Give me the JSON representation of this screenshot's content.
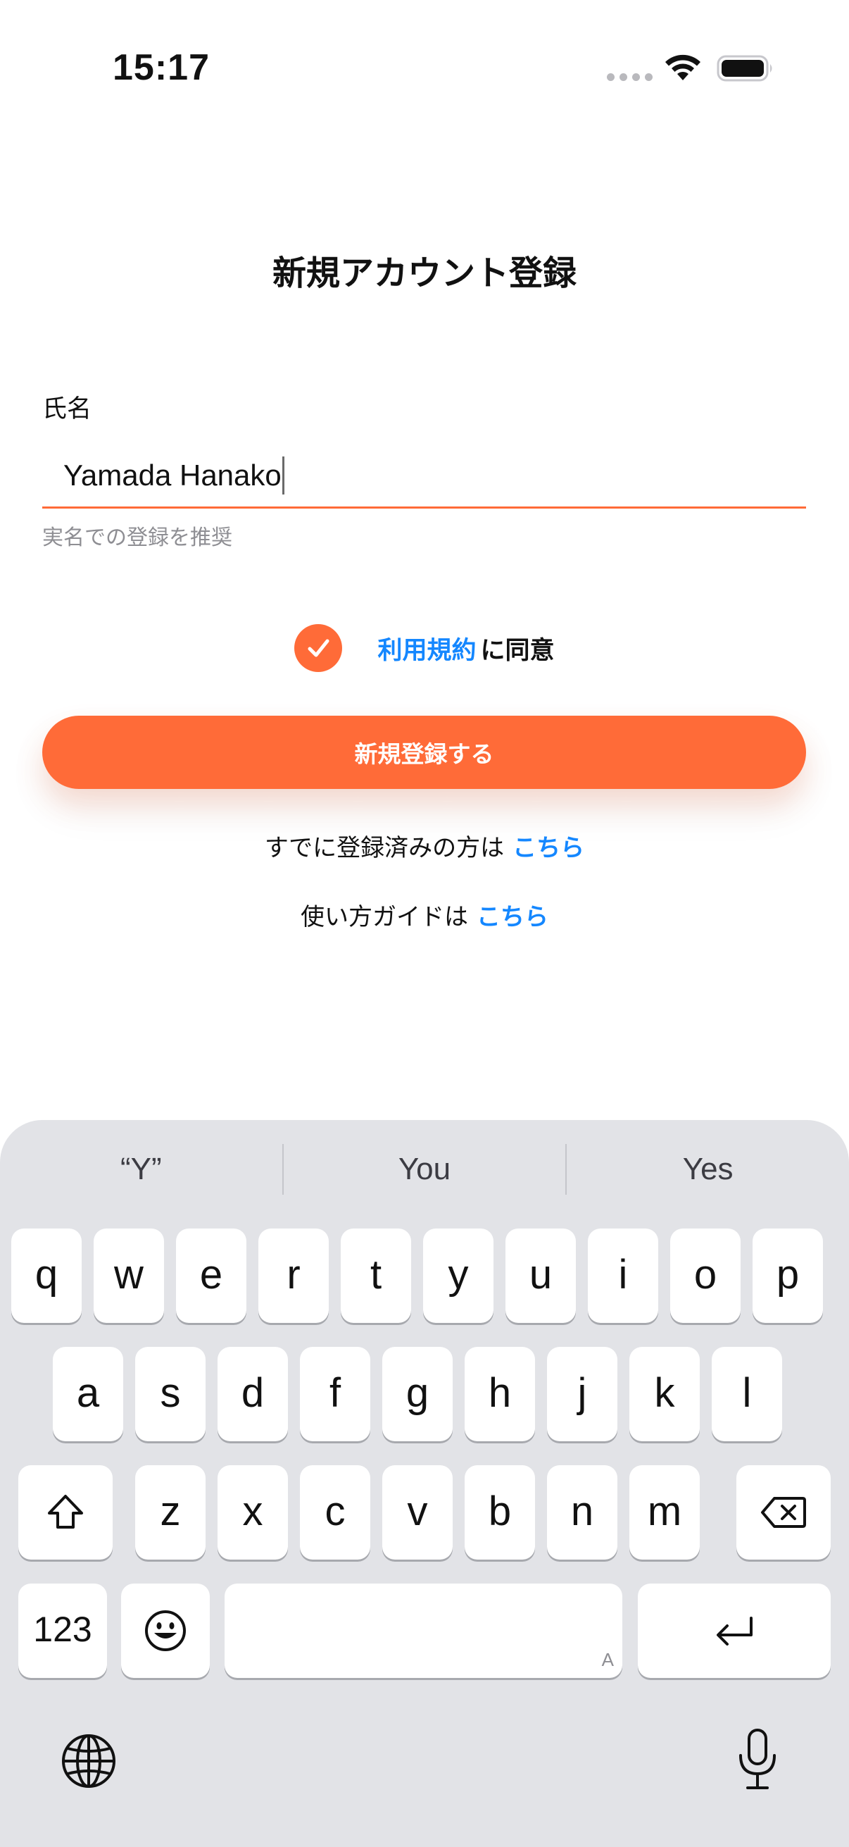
{
  "status_bar": {
    "time": "15:17",
    "icons": [
      "signal-dots-icon",
      "wifi-icon",
      "battery-icon"
    ]
  },
  "page": {
    "title": "新規アカウント登録"
  },
  "form": {
    "name_label": "氏名",
    "name_value": "Yamada Hanako",
    "name_hint": "実名での登録を推奨",
    "terms_checked": true,
    "terms_link": "利用規約",
    "terms_text": "に同意",
    "register_button": "新規登録する"
  },
  "links": {
    "login_text": "すでに登録済みの方は",
    "login_link": "こちら",
    "guide_text": "使い方ガイドは",
    "guide_link": "こちら"
  },
  "colors": {
    "accent": "#ff6b38",
    "link": "#1487ff",
    "hint": "#8e8e93",
    "keyboard_bg": "#e2e3e7"
  },
  "keyboard": {
    "suggestions": [
      "“Y”",
      "You",
      "Yes"
    ],
    "row1": [
      "q",
      "w",
      "e",
      "r",
      "t",
      "y",
      "u",
      "i",
      "o",
      "p"
    ],
    "row2": [
      "a",
      "s",
      "d",
      "f",
      "g",
      "h",
      "j",
      "k",
      "l"
    ],
    "row3": [
      "z",
      "x",
      "c",
      "v",
      "b",
      "n",
      "m"
    ],
    "numbers_key": "123",
    "space_hint": "A",
    "icons": [
      "shift-icon",
      "backspace-icon",
      "emoji-icon",
      "return-icon",
      "globe-icon",
      "microphone-icon"
    ]
  }
}
